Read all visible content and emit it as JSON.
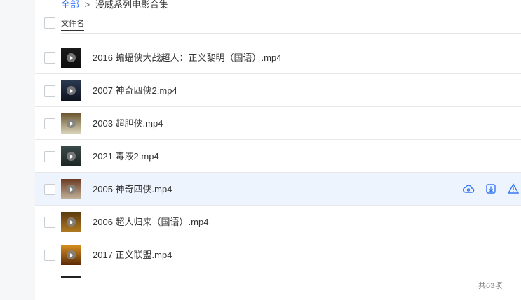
{
  "breadcrumb": {
    "root": "全部",
    "separator": ">",
    "current": "漫威系列电影合集"
  },
  "header": {
    "name_column": "文件名"
  },
  "files": [
    {
      "name": "2016 蝙蝠侠大战超人：正义黎明（国语）.mp4",
      "thumb_top": "#1a1a1a",
      "thumb_bottom": "#0d0d0d"
    },
    {
      "name": "2007 神奇四侠2.mp4",
      "thumb_top": "#2a3850",
      "thumb_bottom": "#0e1420"
    },
    {
      "name": "2003 超胆侠.mp4",
      "thumb_top": "#6a5630",
      "thumb_bottom": "#d8d2b8"
    },
    {
      "name": "2021 毒液2.mp4",
      "thumb_top": "#3a4a48",
      "thumb_bottom": "#1c2624"
    },
    {
      "name": "2005 神奇四侠.mp4",
      "thumb_top": "#6b3a22",
      "thumb_bottom": "#c4b59c"
    },
    {
      "name": "2006 超人归来（国语）.mp4",
      "thumb_top": "#5a3a10",
      "thumb_bottom": "#b07a20"
    },
    {
      "name": "2017 正义联盟.mp4",
      "thumb_top": "#d89020",
      "thumb_bottom": "#5a2a08"
    }
  ],
  "hover_actions": {
    "icons": [
      "cloud-save-icon",
      "download-icon",
      "report-icon"
    ],
    "color": "#3478f6"
  },
  "footer": {
    "total": "共63项"
  },
  "colors": {
    "accent": "#3478f6",
    "hover_row": "#eef4fd",
    "text": "#333333"
  }
}
